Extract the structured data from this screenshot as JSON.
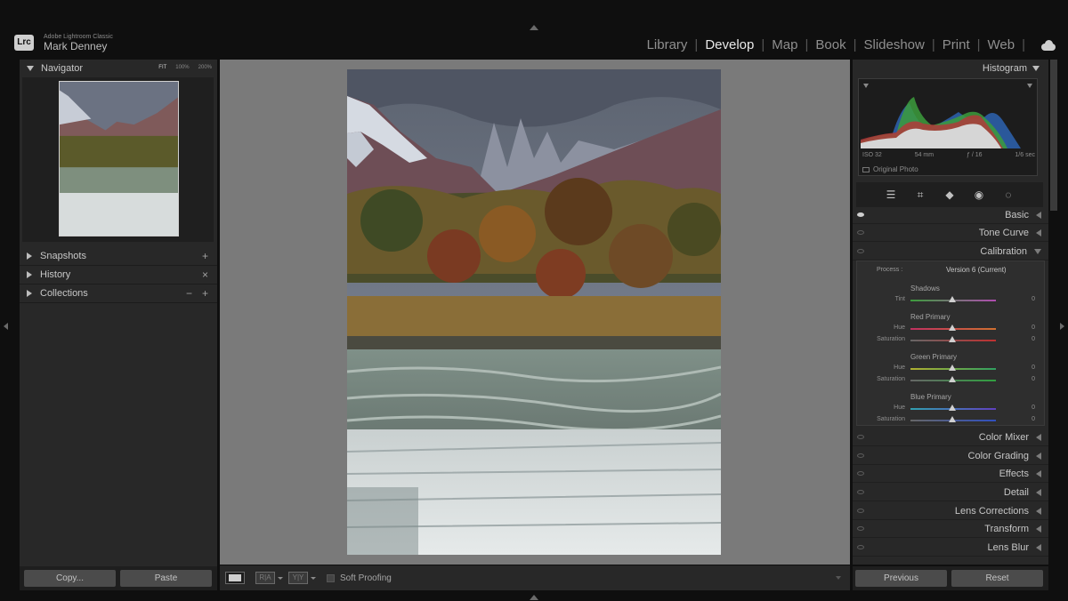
{
  "app": {
    "logo": "Lrc",
    "product": "Adobe Lightroom Classic",
    "user": "Mark Denney"
  },
  "modules": [
    "Library",
    "Develop",
    "Map",
    "Book",
    "Slideshow",
    "Print",
    "Web"
  ],
  "active_module": "Develop",
  "left_panel": {
    "navigator": {
      "title": "Navigator",
      "zoom_options": [
        "FIT",
        "100%",
        "200%"
      ]
    },
    "snapshots": {
      "label": "Snapshots",
      "action": "+"
    },
    "history": {
      "label": "History",
      "action": "×"
    },
    "collections": {
      "label": "Collections",
      "action_minus": "−",
      "action_plus": "+"
    },
    "copy_label": "Copy...",
    "paste_label": "Paste"
  },
  "toolbar": {
    "soft_proofing_label": "Soft Proofing",
    "view_compare_glyph": "R|A",
    "view_survey_glyph": "Y|Y"
  },
  "right_panel": {
    "histogram": {
      "title": "Histogram",
      "iso": "ISO 32",
      "focal": "54 mm",
      "aperture": "ƒ / 16",
      "shutter": "1/6 sec",
      "original_photo": "Original Photo"
    },
    "sections": {
      "basic": "Basic",
      "tone_curve": "Tone Curve",
      "calibration": "Calibration",
      "color_mixer": "Color Mixer",
      "color_grading": "Color Grading",
      "effects": "Effects",
      "detail": "Detail",
      "lens_corrections": "Lens Corrections",
      "transform": "Transform",
      "lens_blur": "Lens Blur"
    },
    "calibration": {
      "process_label": "Process :",
      "process_value": "Version 6 (Current)",
      "shadows_title": "Shadows",
      "tint_label": "Tint",
      "tint_value": "0",
      "red_title": "Red Primary",
      "red_hue_label": "Hue",
      "red_hue_value": "0",
      "red_sat_label": "Saturation",
      "red_sat_value": "0",
      "green_title": "Green Primary",
      "green_hue_label": "Hue",
      "green_hue_value": "0",
      "green_sat_label": "Saturation",
      "green_sat_value": "0",
      "blue_title": "Blue Primary",
      "blue_hue_label": "Hue",
      "blue_hue_value": "0",
      "blue_sat_label": "Saturation",
      "blue_sat_value": "0"
    },
    "previous_label": "Previous",
    "reset_label": "Reset"
  },
  "colors": {
    "accent": "#e8e8e8",
    "panel": "#282828",
    "canvas": "#7a7a7a"
  }
}
